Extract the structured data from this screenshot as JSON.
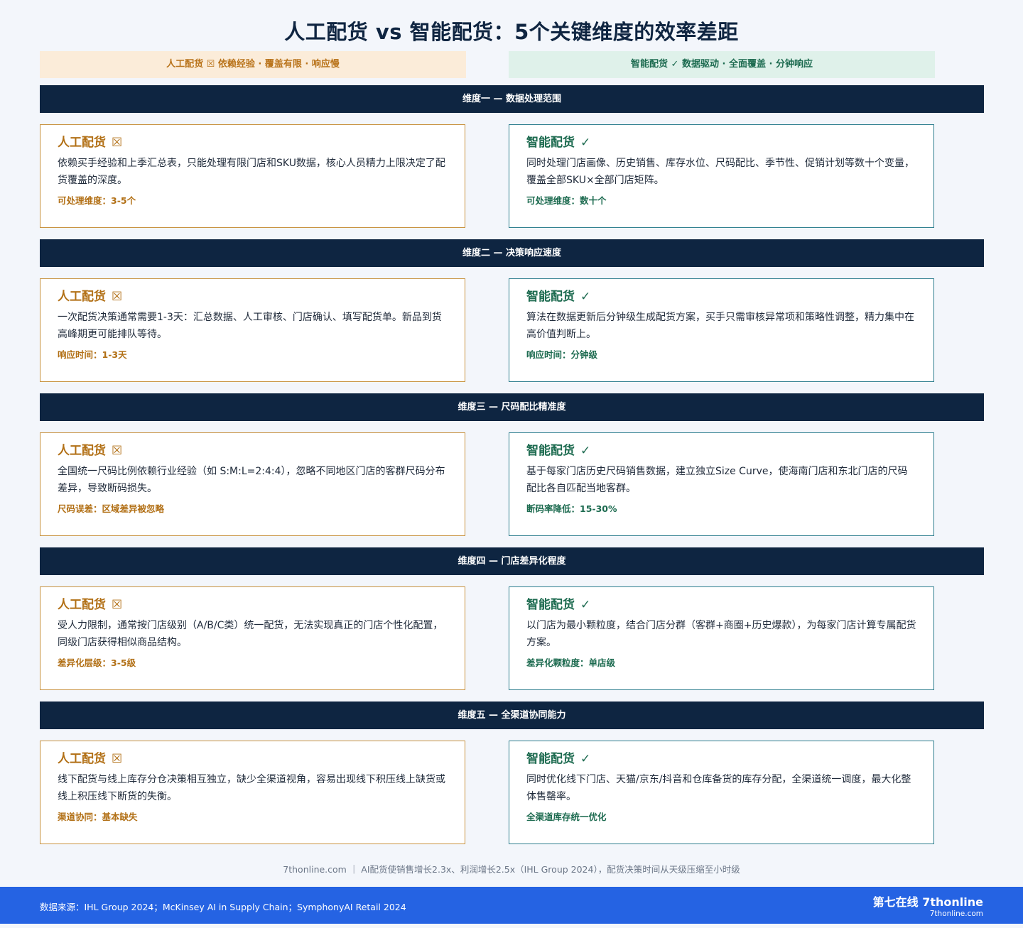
{
  "title": "人工配货 vs 智能配货：5个关键维度的效率差距",
  "legend": {
    "manual": "人工配货 ☒ 依赖经验 · 覆盖有限 · 响应慢",
    "smart": "智能配货 ✓ 数据驱动 · 全面覆盖 · 分钟响应"
  },
  "colors": {
    "manual_accent": "#b27016",
    "smart_accent": "#1d6b50",
    "dimension_bar": "#0e2541",
    "bottom_band": "#2563e3"
  },
  "dimensions": [
    {
      "label": "维度一 — 数据处理范围",
      "manual": {
        "head": "人工配货",
        "mark": "☒",
        "desc": "依赖买手经验和上季汇总表，只能处理有限门店和SKU数据，核心人员精力上限决定了配货覆盖的深度。",
        "metric": "可处理维度：3-5个"
      },
      "smart": {
        "head": "智能配货",
        "mark": "✓",
        "desc": "同时处理门店画像、历史销售、库存水位、尺码配比、季节性、促销计划等数十个变量，覆盖全部SKU×全部门店矩阵。",
        "metric": "可处理维度：数十个"
      }
    },
    {
      "label": "维度二 — 决策响应速度",
      "manual": {
        "head": "人工配货",
        "mark": "☒",
        "desc": "一次配货决策通常需要1-3天：汇总数据、人工审核、门店确认、填写配货单。新品到货高峰期更可能排队等待。",
        "metric": "响应时间：1-3天"
      },
      "smart": {
        "head": "智能配货",
        "mark": "✓",
        "desc": "算法在数据更新后分钟级生成配货方案，买手只需审核异常项和策略性调整，精力集中在高价值判断上。",
        "metric": "响应时间：分钟级"
      }
    },
    {
      "label": "维度三 — 尺码配比精准度",
      "manual": {
        "head": "人工配货",
        "mark": "☒",
        "desc": "全国统一尺码比例依赖行业经验（如 S:M:L=2:4:4），忽略不同地区门店的客群尺码分布差异，导致断码损失。",
        "metric": "尺码误差：区域差异被忽略"
      },
      "smart": {
        "head": "智能配货",
        "mark": "✓",
        "desc": "基于每家门店历史尺码销售数据，建立独立Size Curve，使海南门店和东北门店的尺码配比各自匹配当地客群。",
        "metric": "断码率降低：15-30%"
      }
    },
    {
      "label": "维度四 — 门店差异化程度",
      "manual": {
        "head": "人工配货",
        "mark": "☒",
        "desc": "受人力限制，通常按门店级别（A/B/C类）统一配货，无法实现真正的门店个性化配置，同级门店获得相似商品结构。",
        "metric": "差异化层级：3-5级"
      },
      "smart": {
        "head": "智能配货",
        "mark": "✓",
        "desc": "以门店为最小颗粒度，结合门店分群（客群+商圈+历史爆款），为每家门店计算专属配货方案。",
        "metric": "差异化颗粒度：单店级"
      }
    },
    {
      "label": "维度五 — 全渠道协同能力",
      "manual": {
        "head": "人工配货",
        "mark": "☒",
        "desc": "线下配货与线上库存分仓决策相互独立，缺少全渠道视角，容易出现线下积压线上缺货或线上积压线下断货的失衡。",
        "metric": "渠道协同：基本缺失"
      },
      "smart": {
        "head": "智能配货",
        "mark": "✓",
        "desc": "同时优化线下门店、天猫/京东/抖音和仓库备货的库存分配，全渠道统一调度，最大化整体售罄率。",
        "metric": "全渠道库存统一优化"
      }
    }
  ],
  "footer_note": "7thonline.com ｜ AI配货使销售增长2.3x、利润增长2.5x（IHL Group 2024），配货决策时间从天级压缩至小时级",
  "source": "数据来源：IHL Group 2024；McKinsey AI in Supply Chain；SymphonyAI Retail 2024",
  "brand": {
    "name": "第七在线 7thonline",
    "url": "7thonline.com"
  }
}
